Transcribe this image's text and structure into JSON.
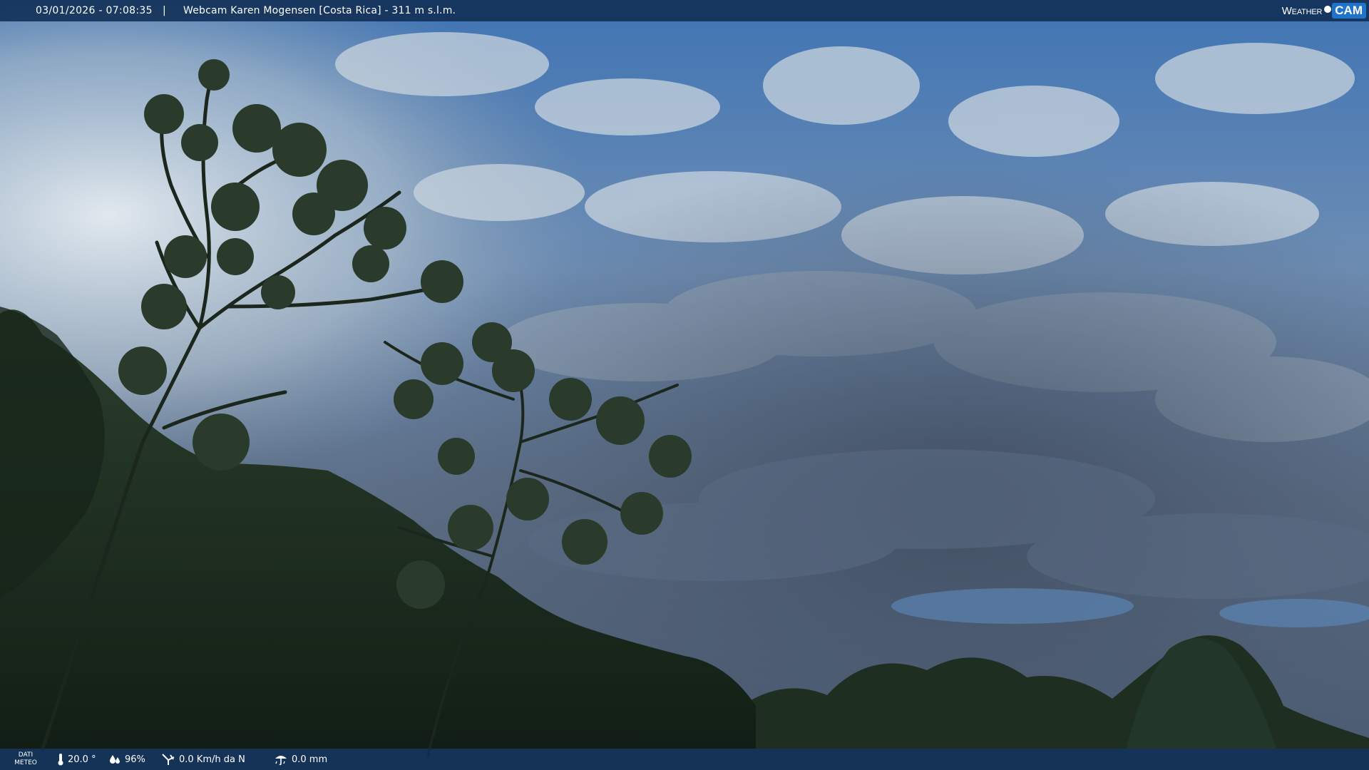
{
  "overlay": {
    "timestamp": "03/01/2026 - 07:08:35",
    "separator": "|",
    "title": "Webcam Karen Mogensen [Costa Rica]  - 311 m s.l.m."
  },
  "logo": {
    "weather": "Weather",
    "cam": "CAM"
  },
  "weather_bar": {
    "label_line1": "DATI",
    "label_line2": "METEO",
    "temperature": "20.0 °",
    "humidity": "96%",
    "wind": "0.0 Km/h da N",
    "rain": "0.0 mm",
    "icons": [
      "thermometer-icon",
      "humidity-drop-icon",
      "wind-icon",
      "rain-icon"
    ]
  },
  "colors": {
    "bar_bg": "#102e54",
    "logo_accent": "#1f74c9",
    "sky_top": "#3f74b4",
    "foliage": "#1c2e1f"
  }
}
